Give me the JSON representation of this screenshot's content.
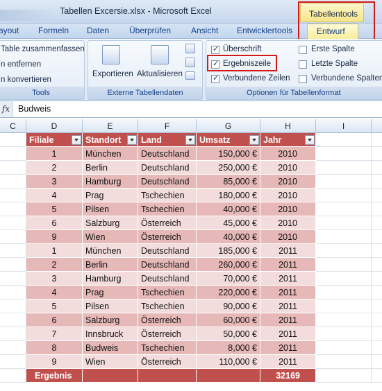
{
  "window": {
    "title": "Tabellen Excersie.xlsx - Microsoft Excel",
    "context_tab_header": "Tabellentools"
  },
  "ribbon_tabs": [
    "ayout",
    "Formeln",
    "Daten",
    "Überprüfen",
    "Ansicht",
    "Entwicklertools"
  ],
  "active_tab": "Entwurf",
  "ribbon": {
    "tools": {
      "items": [
        "Table zusammenfassen",
        "n entfernen",
        "n konvertieren"
      ],
      "label": "Tools"
    },
    "external": {
      "export": "Exportieren",
      "refresh": "Aktualisieren",
      "label": "Externe Tabellendaten"
    },
    "options": {
      "header_row": "Überschrift",
      "total_row": "Ergebniszeile",
      "banded_rows": "Verbundene Zeilen",
      "first_column": "Erste Spalte",
      "last_column": "Letzte Spalte",
      "banded_columns": "Verbundene Spalten",
      "label": "Optionen für Tabellenformat",
      "state": {
        "header_row": true,
        "total_row": true,
        "banded_rows": true,
        "first_column": false,
        "last_column": false,
        "banded_columns": false
      }
    }
  },
  "formula_bar": {
    "fx": "fx",
    "value": "Budweis"
  },
  "columns": [
    "C",
    "D",
    "E",
    "F",
    "G",
    "H",
    "I"
  ],
  "table": {
    "headers": [
      "Filiale",
      "Standort",
      "Land",
      "Umsatz",
      "Jahr"
    ],
    "rows": [
      [
        "1",
        "München",
        "Deutschland",
        "150,000 €",
        "2010"
      ],
      [
        "2",
        "Berlin",
        "Deutschland",
        "250,000 €",
        "2010"
      ],
      [
        "3",
        "Hamburg",
        "Deutschland",
        "85,000 €",
        "2010"
      ],
      [
        "4",
        "Prag",
        "Tschechien",
        "180,000 €",
        "2010"
      ],
      [
        "5",
        "Pilsen",
        "Tschechien",
        "40,000 €",
        "2010"
      ],
      [
        "6",
        "Salzburg",
        "Österreich",
        "45,000 €",
        "2010"
      ],
      [
        "9",
        "Wien",
        "Österreich",
        "40,000 €",
        "2010"
      ],
      [
        "1",
        "München",
        "Deutschland",
        "185,000 €",
        "2011"
      ],
      [
        "2",
        "Berlin",
        "Deutschland",
        "260,000 €",
        "2011"
      ],
      [
        "3",
        "Hamburg",
        "Deutschland",
        "70,000 €",
        "2011"
      ],
      [
        "4",
        "Prag",
        "Tschechien",
        "220,000 €",
        "2011"
      ],
      [
        "5",
        "Pilsen",
        "Tschechien",
        "90,000 €",
        "2011"
      ],
      [
        "6",
        "Salzburg",
        "Österreich",
        "60,000 €",
        "2011"
      ],
      [
        "7",
        "Innsbruck",
        "Österreich",
        "50,000 €",
        "2011"
      ],
      [
        "8",
        "Budweis",
        "Tschechien",
        "8,000 €",
        "2011"
      ],
      [
        "9",
        "Wien",
        "Österreich",
        "110,000 €",
        "2011"
      ]
    ],
    "total": {
      "label": "Ergebnis",
      "value": "32169"
    }
  },
  "colors": {
    "header_fill": "#c0504d",
    "band_dark": "#e6b8b8",
    "band_light": "#f3dcdc",
    "highlight_box": "#d41818",
    "context_tab": "#f9ec9a"
  }
}
